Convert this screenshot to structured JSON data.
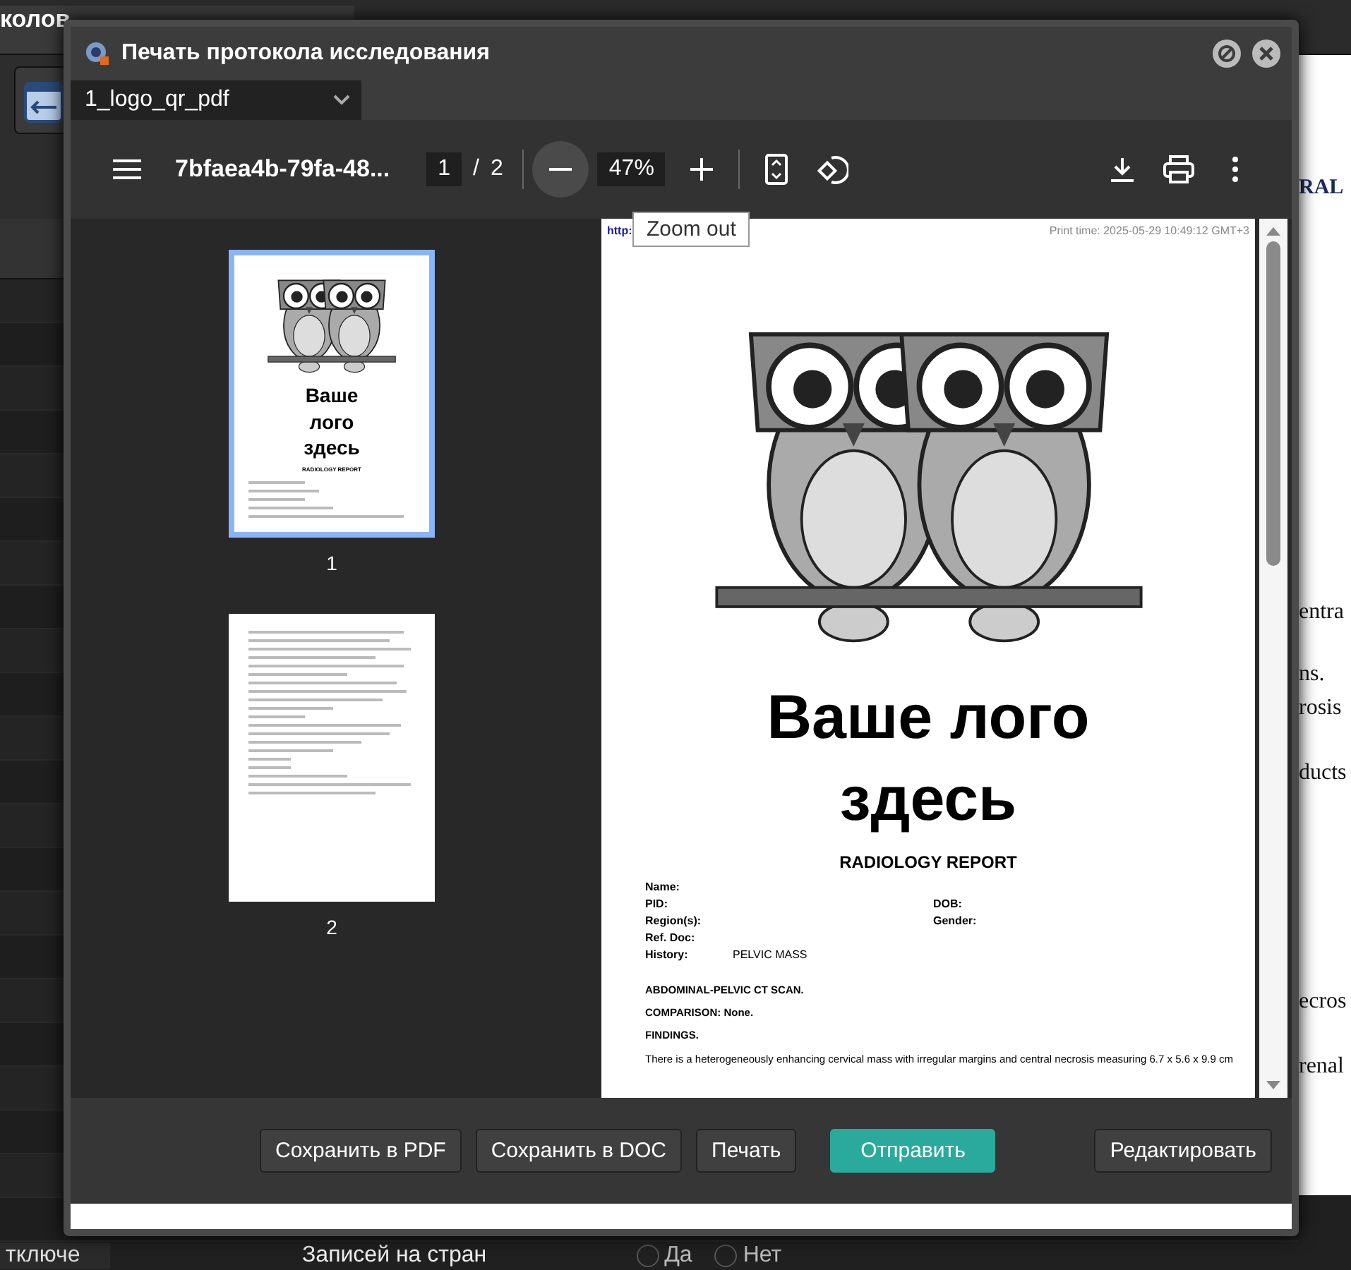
{
  "background_app": {
    "tab_title": "колов",
    "select_value": "тключе",
    "records_label": "Записей на стран",
    "radio_options": [
      {
        "label": "Да",
        "selected": false
      },
      {
        "label": "Нет",
        "selected": false
      }
    ],
    "side_document_lines": [
      "RAL",
      "entra",
      "ns.",
      "rosis",
      "ducts",
      "ecros",
      "renal"
    ]
  },
  "dialog": {
    "title": "Печать протокола исследования",
    "template_select": "1_logo_qr_pdf",
    "viewer": {
      "file_name": "7bfaea4b-79fa-48...",
      "page_input": "1",
      "page_separator": "/",
      "page_count": "2",
      "zoom": "47%",
      "tooltip": "Zoom out"
    },
    "thumbnails": [
      {
        "label": "1",
        "selected": true,
        "kind": "cover",
        "heading": "Ваше лого здесь",
        "subheading": "RADIOLOGY REPORT"
      },
      {
        "label": "2",
        "selected": false,
        "kind": "text"
      }
    ],
    "page": {
      "link": "http:",
      "print_time": "Print time: 2025-05-29 10:49:12 GMT+3",
      "logo_lines": [
        "Ваше лого",
        "здесь"
      ],
      "report_title": "RADIOLOGY REPORT",
      "fields": [
        {
          "label": "Name:"
        },
        {
          "label": "PID:",
          "right_label": "DOB:"
        },
        {
          "label": "Region(s):",
          "right_label": "Gender:"
        },
        {
          "label": "Ref. Doc:"
        },
        {
          "label": "History:",
          "value": "PELVIC MASS"
        }
      ],
      "sections": [
        "ABDOMINAL-PELVIC CT SCAN.",
        "COMPARISON: None.",
        "FINDINGS."
      ],
      "body": "There is a heterogeneously enhancing cervical mass with irregular margins and central necrosis measuring 6.7 x 5.6 x 9.9 cm"
    },
    "buttons": [
      {
        "label": "Сохранить в PDF",
        "kind": "default"
      },
      {
        "label": "Сохранить в DOC",
        "kind": "default"
      },
      {
        "label": "Печать",
        "kind": "default"
      },
      {
        "label": "Отправить",
        "kind": "primary"
      },
      {
        "label": "Редактировать",
        "kind": "default"
      }
    ]
  }
}
